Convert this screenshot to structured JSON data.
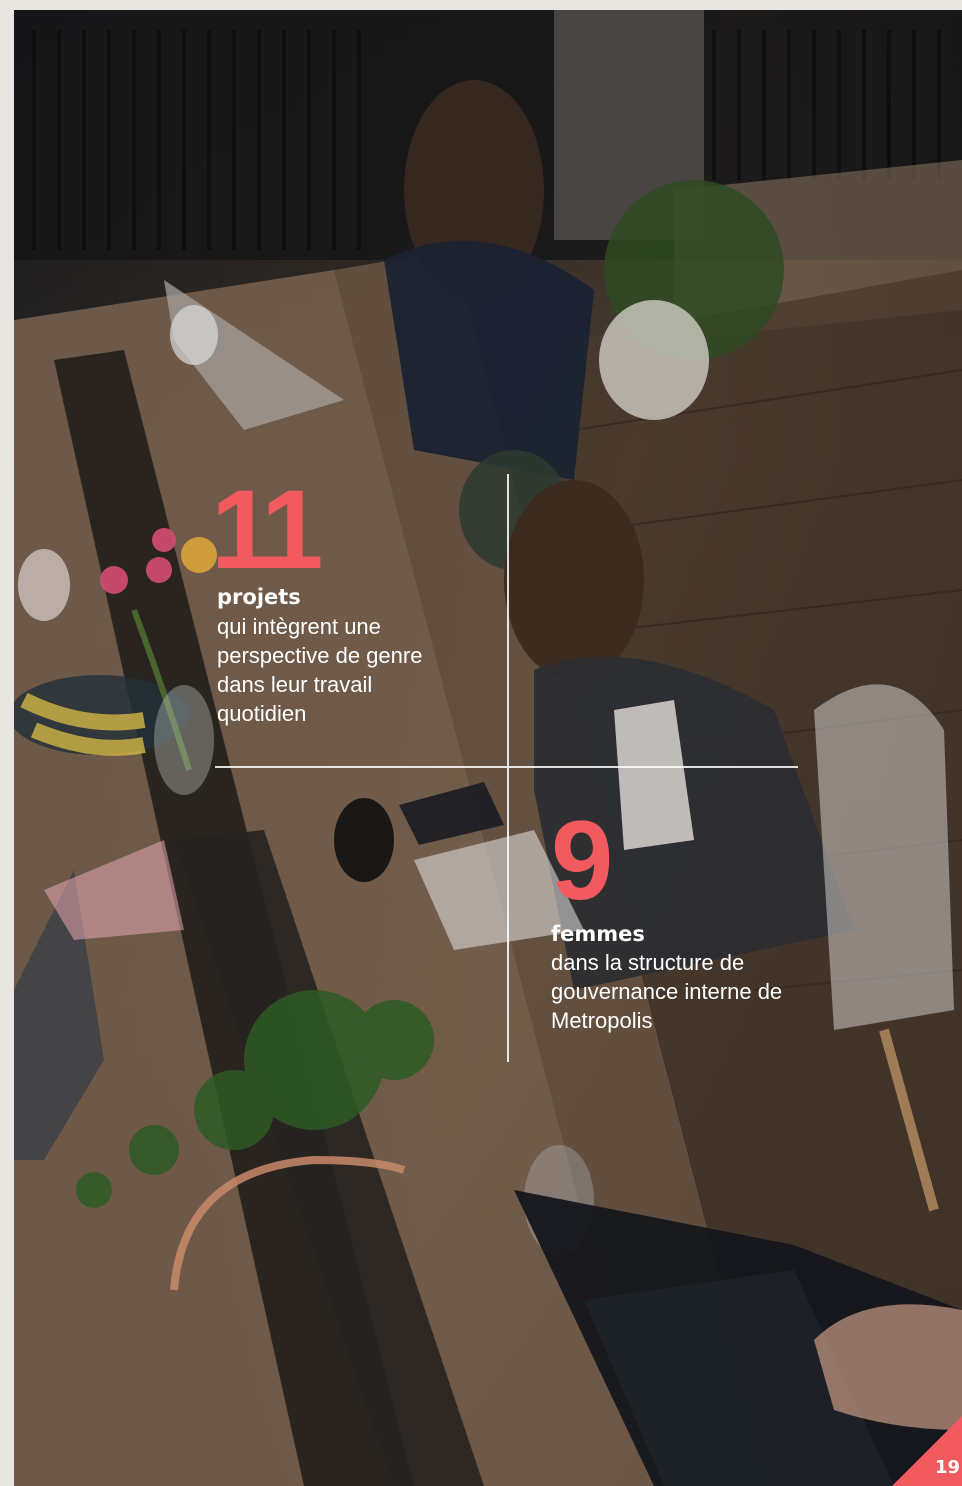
{
  "stats": [
    {
      "number": "11",
      "label": "projets",
      "description": [
        "qui intègrent une",
        "perspective de genre",
        "dans leur travail",
        "quotidien"
      ]
    },
    {
      "number": "9",
      "label": "femmes",
      "description": [
        "dans la structure de",
        "gouvernance interne de",
        "Metropolis"
      ]
    }
  ],
  "page_number": "19",
  "colors": {
    "accent": "#f15a5f",
    "text": "#ffffff",
    "margin": "#e9e5e1"
  }
}
